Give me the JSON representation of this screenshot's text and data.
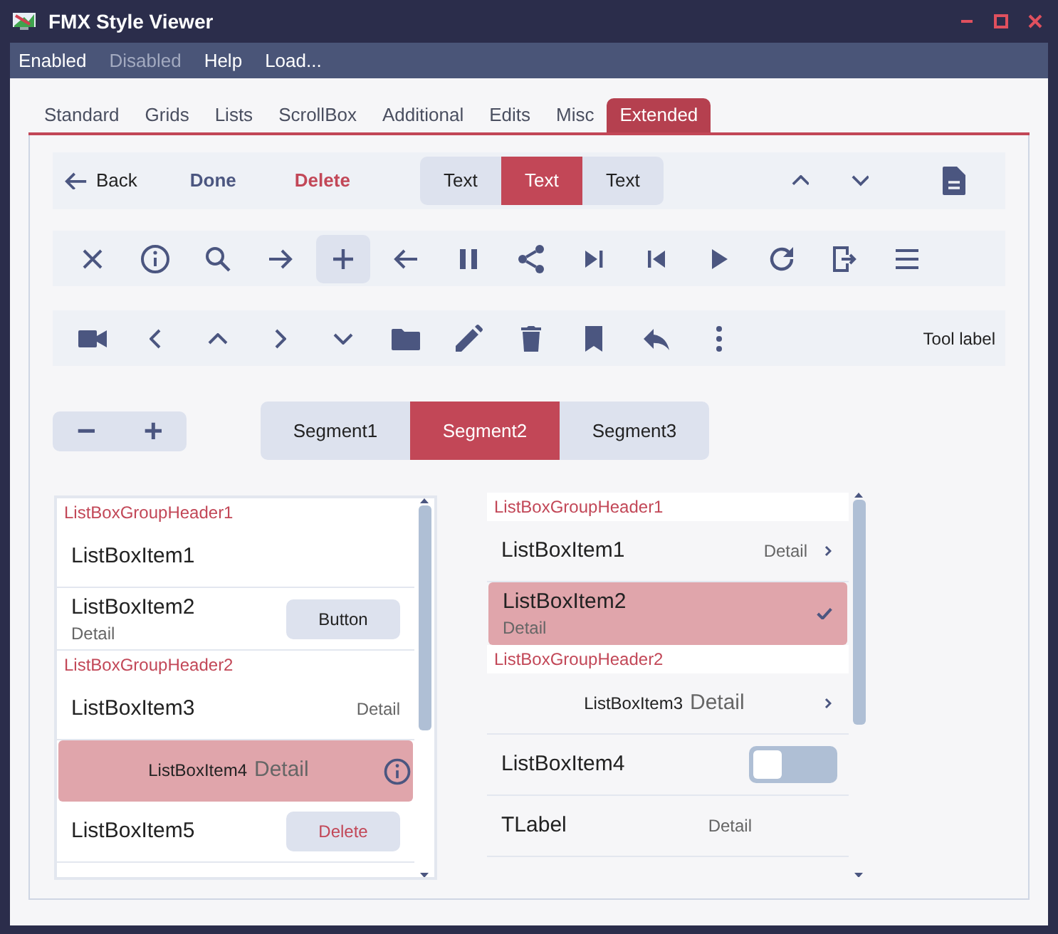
{
  "window": {
    "title": "FMX Style Viewer"
  },
  "menu": [
    {
      "label": "Enabled",
      "disabled": false
    },
    {
      "label": "Disabled",
      "disabled": true
    },
    {
      "label": "Help",
      "disabled": false
    },
    {
      "label": "Load...",
      "disabled": false
    }
  ],
  "tabs": [
    {
      "label": "Standard",
      "selected": false
    },
    {
      "label": "Grids",
      "selected": false
    },
    {
      "label": "Lists",
      "selected": false
    },
    {
      "label": "ScrollBox",
      "selected": false
    },
    {
      "label": "Additional",
      "selected": false
    },
    {
      "label": "Edits",
      "selected": false
    },
    {
      "label": "Misc",
      "selected": false
    },
    {
      "label": "Extended",
      "selected": true
    }
  ],
  "toolbar_1": {
    "back": "Back",
    "done": "Done",
    "delete": "Delete",
    "segments": [
      {
        "label": "Text",
        "selected": false
      },
      {
        "label": "Text",
        "selected": true
      },
      {
        "label": "Text",
        "selected": false
      }
    ]
  },
  "toolbar_2": {
    "buttons": [
      {
        "selected": false
      },
      {
        "selected": false
      },
      {
        "selected": false
      },
      {
        "selected": false
      },
      {
        "selected": true
      },
      {
        "selected": false
      },
      {
        "selected": false
      },
      {
        "selected": false
      },
      {
        "selected": false
      },
      {
        "selected": false
      },
      {
        "selected": false
      },
      {
        "selected": false
      },
      {
        "selected": false
      },
      {
        "selected": false
      }
    ]
  },
  "toolbar_3": {
    "label": "Tool label"
  },
  "segments": [
    {
      "label": "Segment1",
      "selected": false
    },
    {
      "label": "Segment2",
      "selected": true
    },
    {
      "label": "Segment3",
      "selected": false
    }
  ],
  "list_left": {
    "rows": [
      {
        "kind": "header",
        "text": "ListBoxGroupHeader1"
      },
      {
        "kind": "item",
        "text": "ListBoxItem1",
        "selected": false
      },
      {
        "kind": "item",
        "text": "ListBoxItem2",
        "subtitle": "Detail",
        "selected": false,
        "accessory": {
          "kind": "button",
          "label": "Button"
        }
      },
      {
        "kind": "header",
        "text": "ListBoxGroupHeader2"
      },
      {
        "kind": "item",
        "text": "ListBoxItem3",
        "detail": "Detail",
        "selected": false
      },
      {
        "kind": "inline",
        "text": "ListBoxItem4",
        "detail": "Detail",
        "selected": true,
        "accessory": {
          "kind": "info"
        }
      },
      {
        "kind": "item",
        "text": "ListBoxItem5",
        "selected": false,
        "accessory": {
          "kind": "delete_button",
          "label": "Delete"
        }
      }
    ]
  },
  "list_right": {
    "rows": [
      {
        "kind": "header",
        "text": "ListBoxGroupHeader1"
      },
      {
        "kind": "item",
        "text": "ListBoxItem1",
        "detail": "Detail",
        "selected": false,
        "accessory": {
          "kind": "chevron"
        }
      },
      {
        "kind": "item",
        "text": "ListBoxItem2",
        "subtitle": "Detail",
        "selected": true,
        "accessory": {
          "kind": "check"
        }
      },
      {
        "kind": "header",
        "text": "ListBoxGroupHeader2"
      },
      {
        "kind": "inline",
        "text": "ListBoxItem3",
        "detail": "Detail",
        "selected": false,
        "accessory": {
          "kind": "chevron"
        }
      },
      {
        "kind": "item",
        "text": "ListBoxItem4",
        "selected": false,
        "accessory": {
          "kind": "switch",
          "on": false
        }
      },
      {
        "kind": "item",
        "text": "TLabel",
        "detail": "Detail",
        "selected": false
      }
    ]
  }
}
